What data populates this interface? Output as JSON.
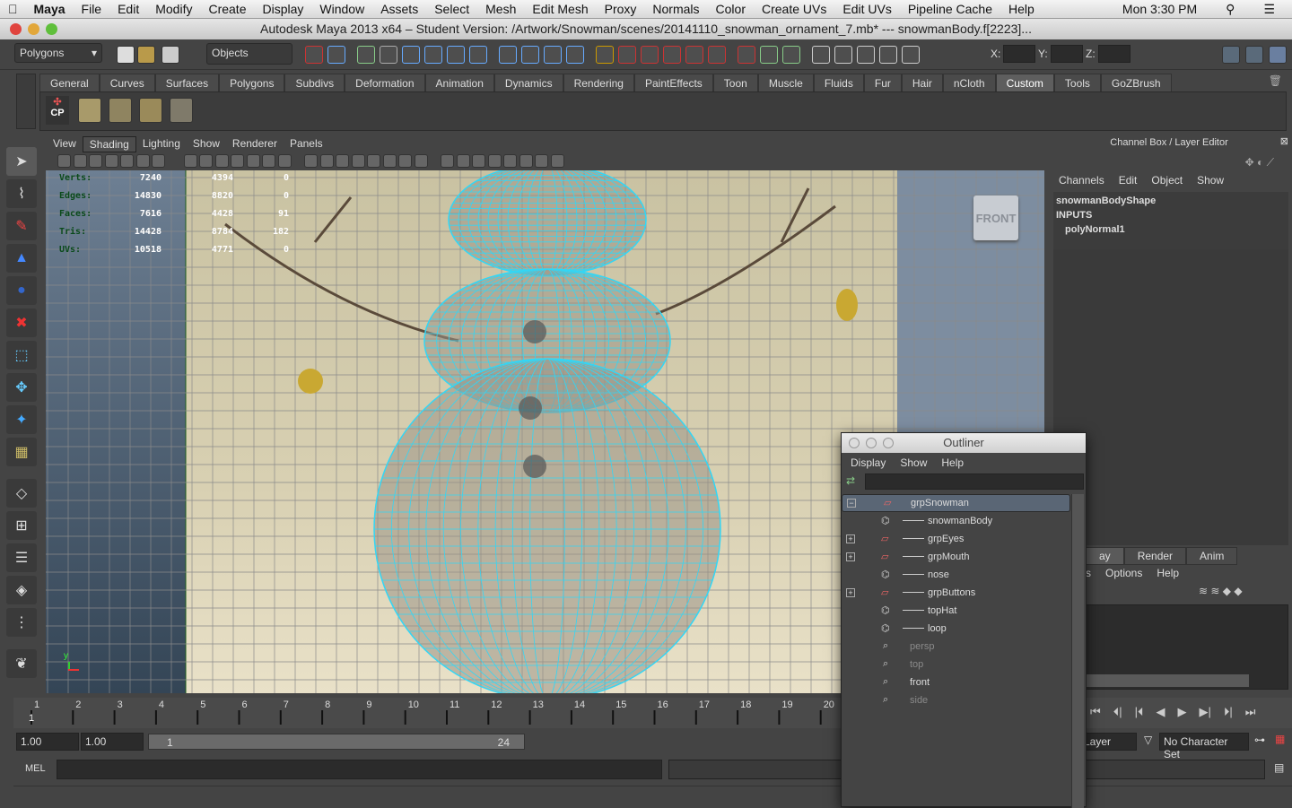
{
  "menubar": {
    "apple": "",
    "app": "Maya",
    "items": [
      "File",
      "Edit",
      "Modify",
      "Create",
      "Display",
      "Window",
      "Assets",
      "Select",
      "Mesh",
      "Edit Mesh",
      "Proxy",
      "Normals",
      "Color",
      "Create UVs",
      "Edit UVs",
      "Pipeline Cache",
      "Help"
    ],
    "clock": "Mon 3:30 PM"
  },
  "window": {
    "title": "Autodesk Maya 2013 x64 – Student Version: /Artwork/Snowman/scenes/20141110_snowman_ornament_7.mb*  ---   snowmanBody.f[2223]..."
  },
  "status_line": {
    "menu_set": "Polygons",
    "selection_mode": "Objects",
    "x_label": "X:",
    "y_label": "Y:",
    "z_label": "Z:"
  },
  "shelf": {
    "tabs": [
      "General",
      "Curves",
      "Surfaces",
      "Polygons",
      "Subdivs",
      "Deformation",
      "Animation",
      "Dynamics",
      "Rendering",
      "PaintEffects",
      "Toon",
      "Muscle",
      "Fluids",
      "Fur",
      "Hair",
      "nCloth",
      "Custom",
      "Tools",
      "GoZBrush"
    ],
    "active": "Custom",
    "cp_label": "CP"
  },
  "viewport": {
    "menu": [
      "View",
      "Shading",
      "Lighting",
      "Show",
      "Renderer",
      "Panels"
    ],
    "active_menu": "Shading",
    "camera": "FRONT",
    "hud": [
      {
        "label": "Verts:",
        "v1": "7240",
        "v2": "4394",
        "v3": "0"
      },
      {
        "label": "Edges:",
        "v1": "14830",
        "v2": "8820",
        "v3": "0"
      },
      {
        "label": "Faces:",
        "v1": "7616",
        "v2": "4428",
        "v3": "91"
      },
      {
        "label": "Tris:",
        "v1": "14428",
        "v2": "8784",
        "v3": "182"
      },
      {
        "label": "UVs:",
        "v1": "10518",
        "v2": "4771",
        "v3": "0"
      }
    ],
    "axis_y": "y"
  },
  "channel_box": {
    "title": "Channel Box / Layer Editor",
    "menu": [
      "Channels",
      "Edit",
      "Object",
      "Show"
    ],
    "shape": "snowmanBodyShape",
    "inputs": "INPUTS",
    "input_node": "polyNormal1"
  },
  "layer_editor": {
    "tabs": [
      "ay",
      "Render",
      "Anim"
    ],
    "menu": [
      "s",
      "Options",
      "Help"
    ]
  },
  "time_slider": {
    "ticks": [
      "1",
      "2",
      "3",
      "4",
      "5",
      "6",
      "7",
      "8",
      "9",
      "10",
      "11",
      "12",
      "13",
      "14",
      "15",
      "16",
      "17",
      "18",
      "19",
      "20"
    ],
    "current": "1"
  },
  "range": {
    "start": "1.00",
    "anim_start": "1.00",
    "range_start": "1",
    "range_end": "24",
    "anim_layer": "n Layer",
    "character_set": "No Character Set"
  },
  "mel": {
    "label": "MEL"
  },
  "outliner": {
    "title": "Outliner",
    "menu": [
      "Display",
      "Show",
      "Help"
    ],
    "items": [
      {
        "name": "grpSnowman",
        "level": 0,
        "expand": "−",
        "selected": true,
        "dim": false,
        "icon": "group"
      },
      {
        "name": "snowmanBody",
        "level": 1,
        "expand": "",
        "selected": false,
        "dim": false,
        "icon": "mesh"
      },
      {
        "name": "grpEyes",
        "level": 1,
        "expand": "+",
        "selected": false,
        "dim": false,
        "icon": "group"
      },
      {
        "name": "grpMouth",
        "level": 1,
        "expand": "+",
        "selected": false,
        "dim": false,
        "icon": "group"
      },
      {
        "name": "nose",
        "level": 1,
        "expand": "",
        "selected": false,
        "dim": false,
        "icon": "mesh"
      },
      {
        "name": "grpButtons",
        "level": 1,
        "expand": "+",
        "selected": false,
        "dim": false,
        "icon": "group"
      },
      {
        "name": "topHat",
        "level": 1,
        "expand": "",
        "selected": false,
        "dim": false,
        "icon": "mesh"
      },
      {
        "name": "loop",
        "level": 1,
        "expand": "",
        "selected": false,
        "dim": false,
        "icon": "mesh"
      },
      {
        "name": "persp",
        "level": 0,
        "expand": "",
        "selected": false,
        "dim": true,
        "icon": "camera"
      },
      {
        "name": "top",
        "level": 0,
        "expand": "",
        "selected": false,
        "dim": true,
        "icon": "camera"
      },
      {
        "name": "front",
        "level": 0,
        "expand": "",
        "selected": false,
        "dim": false,
        "icon": "camera"
      },
      {
        "name": "side",
        "level": 0,
        "expand": "",
        "selected": false,
        "dim": true,
        "icon": "camera"
      }
    ]
  },
  "colors": {
    "wireframe": "#33d6f5",
    "viewport_bg": "#7d8da0",
    "selection": "#5a6675"
  }
}
